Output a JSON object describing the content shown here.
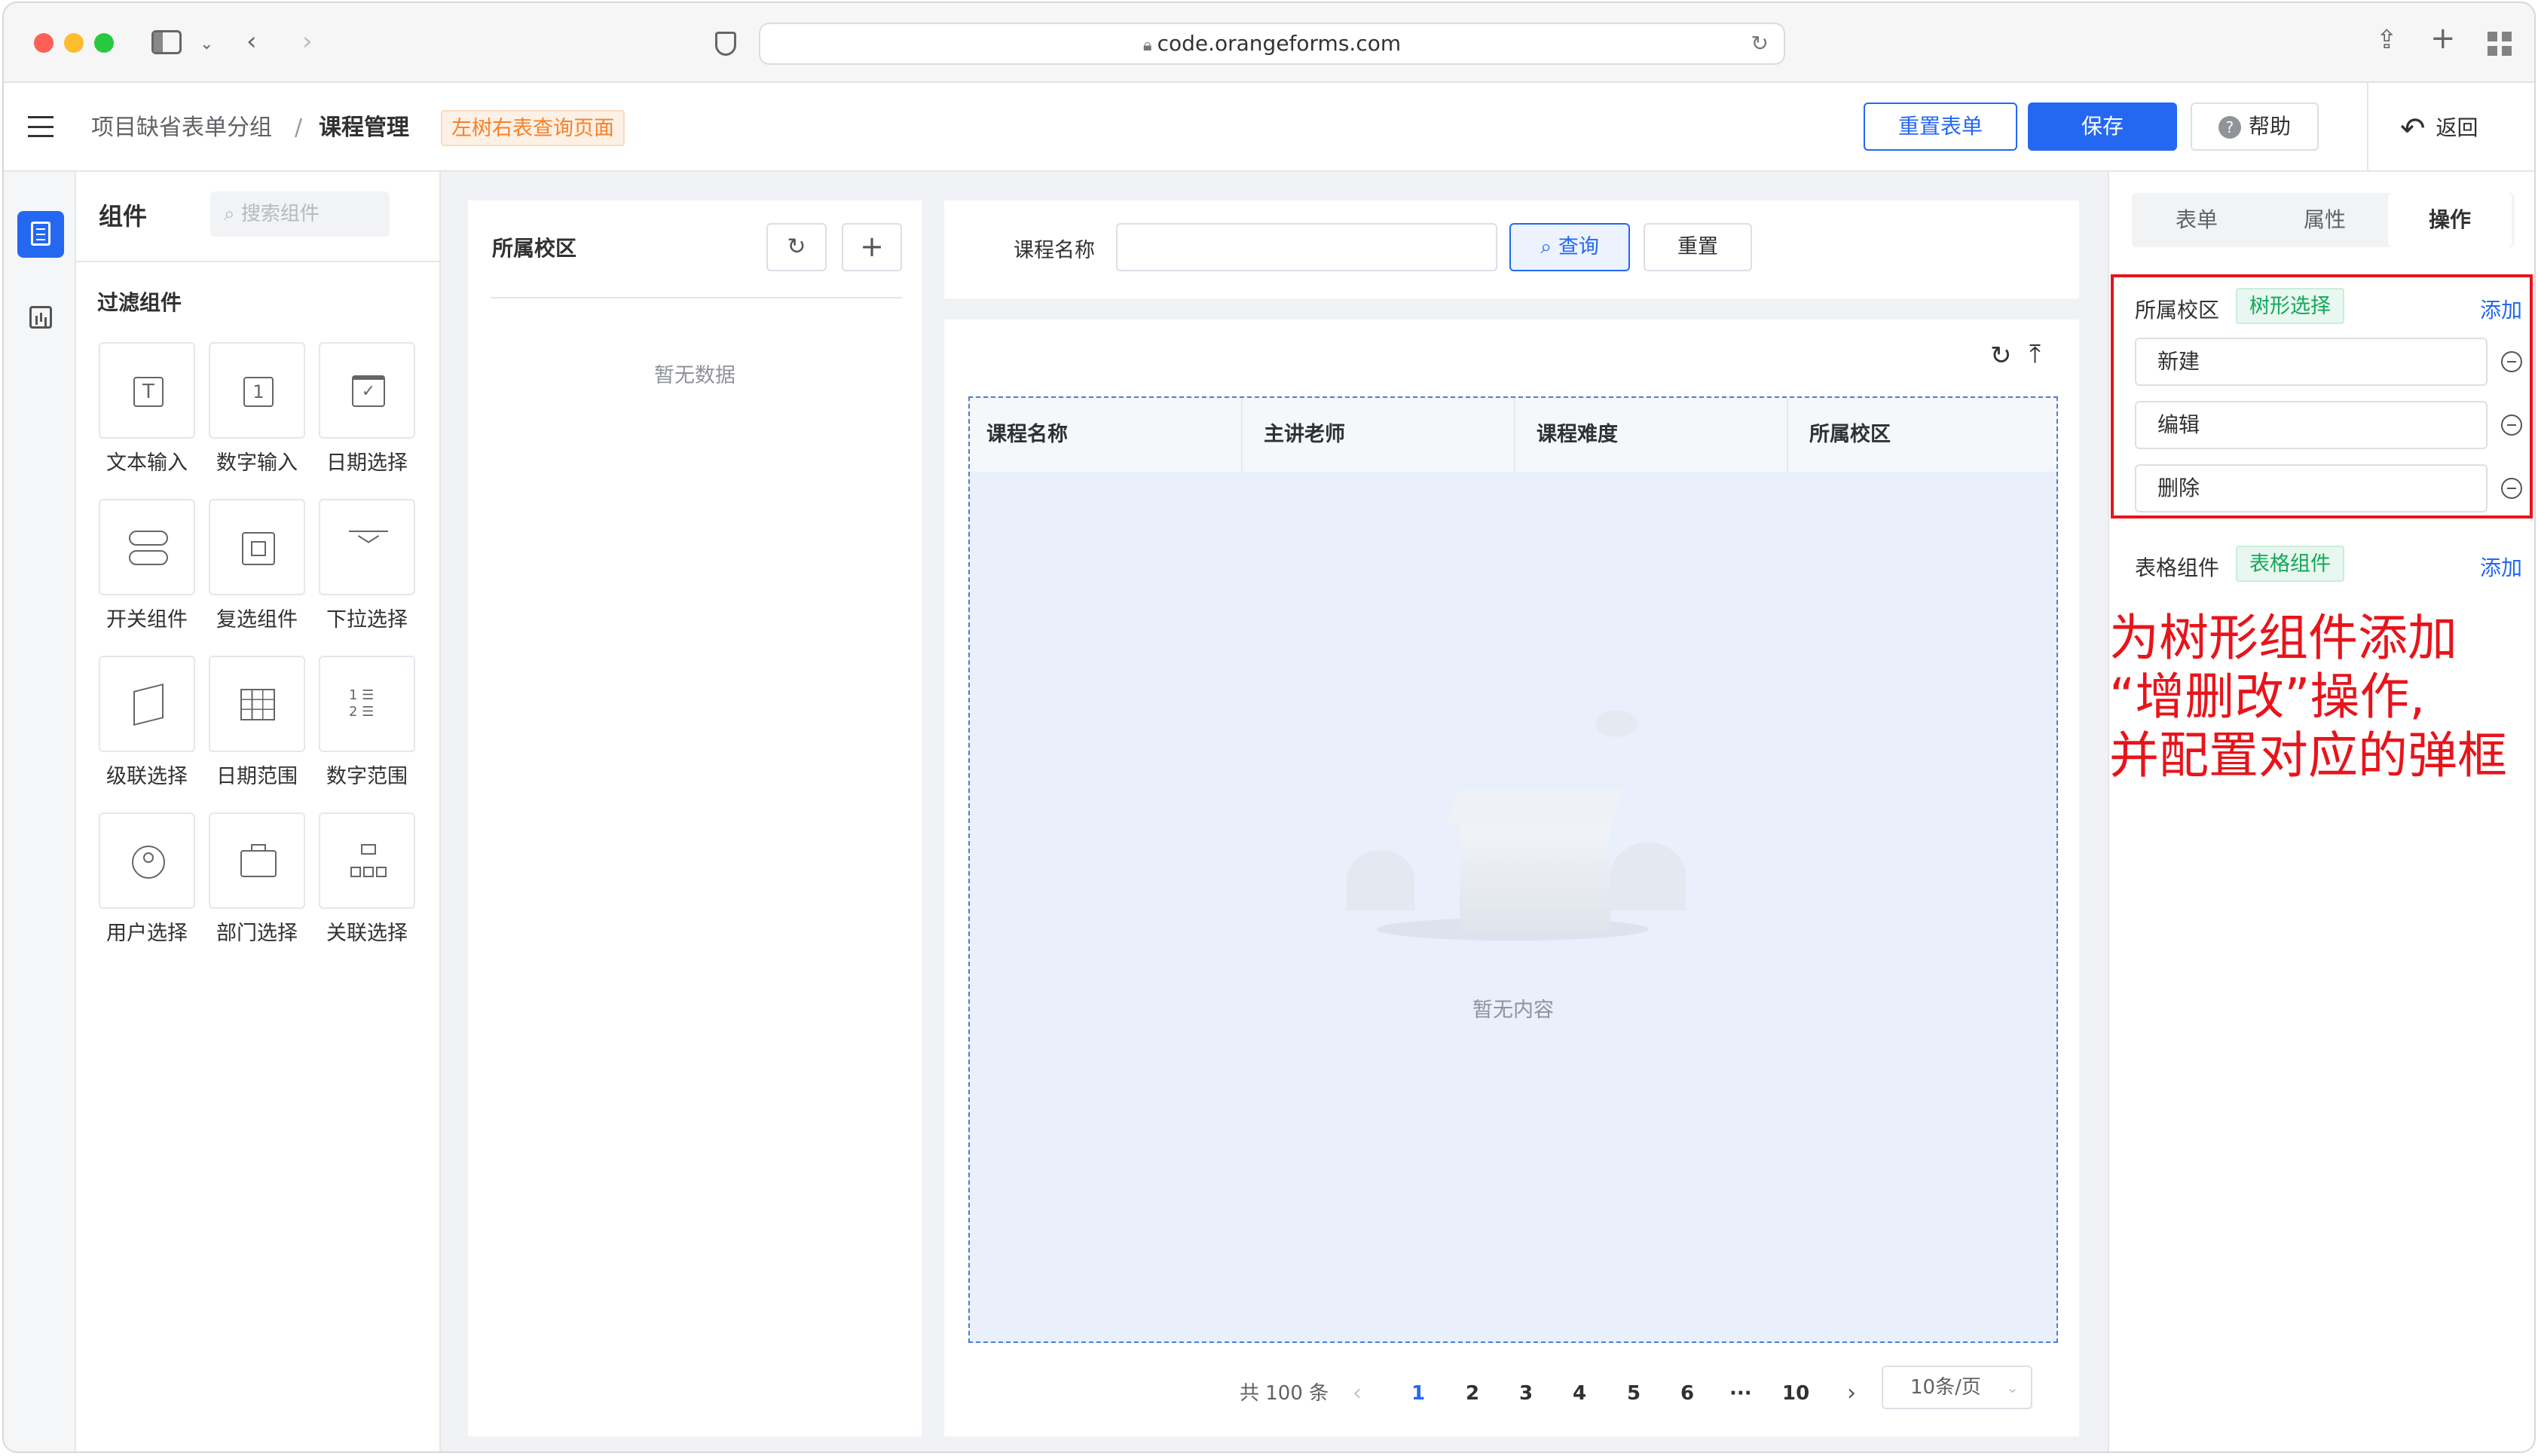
{
  "browser": {
    "url": "code.orangeforms.com"
  },
  "header": {
    "breadcrumb_group": "项目缺省表单分组",
    "breadcrumb_sep": "/",
    "breadcrumb_page": "课程管理",
    "page_type_tag": "左树右表查询页面",
    "reset_form_label": "重置表单",
    "save_label": "保存",
    "help_label": "帮助",
    "back_label": "返回"
  },
  "components": {
    "title": "组件",
    "search_placeholder": "搜索组件",
    "section_title": "过滤组件",
    "items": [
      {
        "label": "文本输入",
        "icon": "text-input-icon"
      },
      {
        "label": "数字输入",
        "icon": "number-input-icon"
      },
      {
        "label": "日期选择",
        "icon": "date-picker-icon"
      },
      {
        "label": "开关组件",
        "icon": "switch-icon"
      },
      {
        "label": "复选组件",
        "icon": "checkbox-icon"
      },
      {
        "label": "下拉选择",
        "icon": "dropdown-icon"
      },
      {
        "label": "级联选择",
        "icon": "cascader-icon"
      },
      {
        "label": "日期范围",
        "icon": "date-range-icon"
      },
      {
        "label": "数字范围",
        "icon": "number-range-icon"
      },
      {
        "label": "用户选择",
        "icon": "user-select-icon"
      },
      {
        "label": "部门选择",
        "icon": "dept-select-icon"
      },
      {
        "label": "关联选择",
        "icon": "relation-select-icon"
      }
    ]
  },
  "tree": {
    "title": "所属校区",
    "empty": "暂无数据"
  },
  "filter": {
    "course_name_label": "课程名称",
    "query_label": "查询",
    "reset_label": "重置"
  },
  "table": {
    "columns": [
      "课程名称",
      "主讲老师",
      "课程难度",
      "所属校区"
    ],
    "empty": "暂无内容"
  },
  "pagination": {
    "total": "共 100 条",
    "pages": [
      "1",
      "2",
      "3",
      "4",
      "5",
      "6",
      "···",
      "10"
    ],
    "current": "1",
    "page_size": "10条/页"
  },
  "right_panel": {
    "tabs": [
      "表单",
      "属性",
      "操作"
    ],
    "active_tab": "操作",
    "tree_section": {
      "label": "所属校区",
      "tag": "树形选择",
      "add": "添加"
    },
    "operations": [
      "新建",
      "编辑",
      "删除"
    ],
    "table_section": {
      "label": "表格组件",
      "tag": "表格组件",
      "add": "添加"
    }
  },
  "annotation": {
    "line1": "为树形组件添加",
    "line2": "“增删改”操作,",
    "line3": "并配置对应的弹框",
    "color": "#e8141b"
  }
}
